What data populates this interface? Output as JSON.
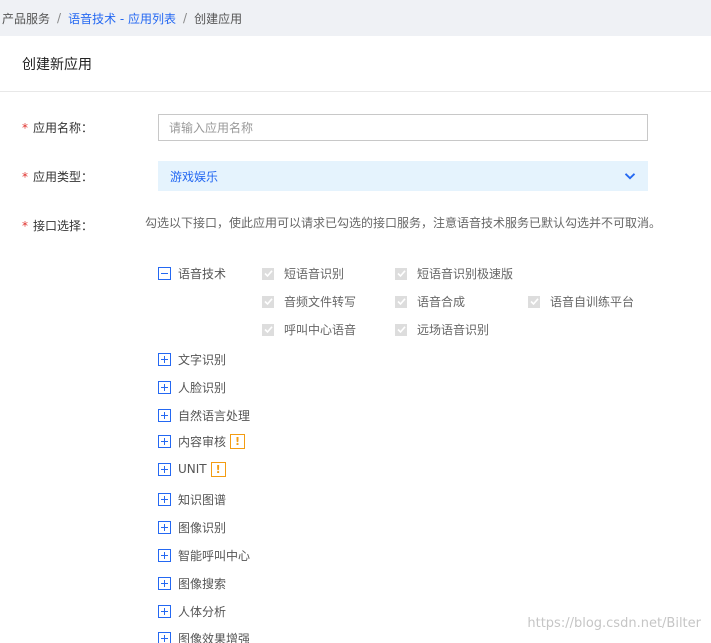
{
  "breadcrumb": {
    "items": [
      "产品服务",
      "语音技术 - 应用列表",
      "创建应用"
    ],
    "separator": "/"
  },
  "card": {
    "title": "创建新应用"
  },
  "form": {
    "required_mark": "*",
    "name": {
      "label": "应用名称：",
      "placeholder": "请输入应用名称",
      "value": ""
    },
    "type": {
      "label": "应用类型：",
      "value": "游戏娱乐"
    },
    "interfaces": {
      "label": "接口选择：",
      "hint": "勾选以下接口，使此应用可以请求已勾选的接口服务，注意语音技术服务已默认勾选并不可取消。"
    }
  },
  "tree": {
    "expanded": {
      "name": "语音技术",
      "options": [
        "短语音识别",
        "短语音识别极速版",
        "音频文件转写",
        "语音合成",
        "语音自训练平台",
        "呼叫中心语音",
        "远场语音识别"
      ],
      "checked": true
    },
    "collapsed": [
      {
        "name": "文字识别",
        "warn": ""
      },
      {
        "name": "人脸识别",
        "warn": ""
      },
      {
        "name": "自然语言处理",
        "warn": ""
      },
      {
        "name": "内容审核",
        "warn": "!"
      },
      {
        "name": "UNIT",
        "warn": "!"
      },
      {
        "name": "知识图谱",
        "warn": ""
      },
      {
        "name": "图像识别",
        "warn": ""
      },
      {
        "name": "智能呼叫中心",
        "warn": ""
      },
      {
        "name": "图像搜索",
        "warn": ""
      },
      {
        "name": "人体分析",
        "warn": ""
      },
      {
        "name": "图像效果增强",
        "warn": ""
      }
    ]
  },
  "watermark": "https://blog.csdn.net/Bilter",
  "colors": {
    "accent": "#2468f2",
    "required": "#e0322e",
    "warning": "#f39c12",
    "select_bg": "#e5f3fd"
  },
  "icons": {
    "collapse": "minus-square-icon",
    "expand": "plus-square-icon",
    "dropdown": "chevron-down-icon",
    "warning": "exclamation-icon",
    "check": "checkmark-icon"
  }
}
